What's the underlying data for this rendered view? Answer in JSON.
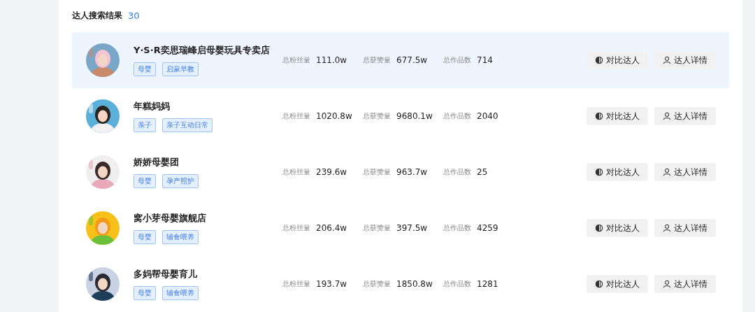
{
  "header": {
    "title": "达人搜索结果",
    "count": "30"
  },
  "rows": [
    {
      "selected": true,
      "avatar": {
        "kind": "picture"
      },
      "name": "Y·S·R奕思瑞峰启母婴玩具专卖店",
      "tags": [
        "母婴",
        "启蒙早教"
      ],
      "stats": [
        {
          "label": "总粉丝量",
          "value": "111.0w"
        },
        {
          "label": "总获赞量",
          "value": "677.5w"
        },
        {
          "label": "总作品数",
          "value": "714"
        }
      ],
      "buttons": [
        "对比达人",
        "达人详情"
      ]
    },
    {
      "selected": false,
      "avatar": {
        "kind": "picture"
      },
      "name": "年糕妈妈",
      "tags": [
        "亲子",
        "亲子互动日常"
      ],
      "stats": [
        {
          "label": "总粉丝量",
          "value": "1020.8w"
        },
        {
          "label": "总获赞量",
          "value": "9680.1w"
        },
        {
          "label": "总作品数",
          "value": "2040"
        }
      ],
      "buttons": [
        "对比达人",
        "达人详情"
      ]
    },
    {
      "selected": false,
      "avatar": {
        "kind": "picture"
      },
      "name": "娇娇母婴团",
      "tags": [
        "母婴",
        "孕产照护"
      ],
      "stats": [
        {
          "label": "总粉丝量",
          "value": "239.6w"
        },
        {
          "label": "总获赞量",
          "value": "963.7w"
        },
        {
          "label": "总作品数",
          "value": "25"
        }
      ],
      "buttons": [
        "对比达人",
        "达人详情"
      ]
    },
    {
      "selected": false,
      "avatar": {
        "kind": "picture"
      },
      "name": "窝小芽母婴旗舰店",
      "tags": [
        "母婴",
        "辅食喂养"
      ],
      "stats": [
        {
          "label": "总粉丝量",
          "value": "206.4w"
        },
        {
          "label": "总获赞量",
          "value": "397.5w"
        },
        {
          "label": "总作品数",
          "value": "4259"
        }
      ],
      "buttons": [
        "对比达人",
        "达人详情"
      ]
    },
    {
      "selected": false,
      "avatar": {
        "kind": "picture"
      },
      "name": "多妈帮母婴育儿",
      "tags": [
        "母婴",
        "辅食喂养"
      ],
      "stats": [
        {
          "label": "总粉丝量",
          "value": "193.7w"
        },
        {
          "label": "总获赞量",
          "value": "1850.8w"
        },
        {
          "label": "总作品数",
          "value": "1281"
        }
      ],
      "buttons": [
        "对比达人",
        "达人详情"
      ]
    }
  ]
}
